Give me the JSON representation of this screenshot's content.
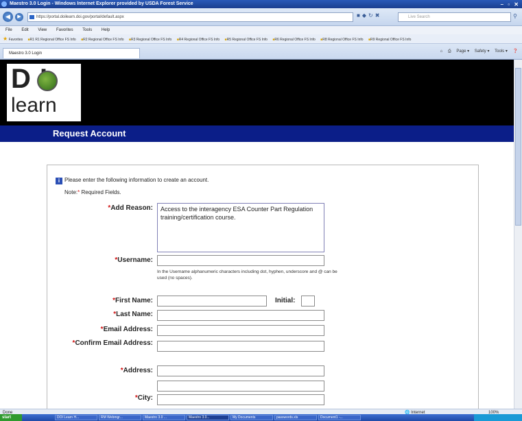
{
  "window": {
    "title": "Maestro 3.0 Login - Windows Internet Explorer provided by USDA Forest Service",
    "controls": "– ▫ ✕"
  },
  "browser": {
    "url": "https://portal.doilearn.doi.gov/portal/default.aspx",
    "search_placeholder": "Live Search",
    "menu": [
      "File",
      "Edit",
      "View",
      "Favorites",
      "Tools",
      "Help"
    ],
    "favorites_label": "Favorites",
    "favorites": [
      "R1 R1 Regional Office FS Info",
      "R2 Regional Office FS Info",
      "R3 Regional Office FS Info",
      "R4 Regional Office FS Info",
      "R5 Regional Office FS Info",
      "R6 Regional Office FS Info",
      "R8 Regional Office FS Info",
      "R9 Regional Office FS Info"
    ],
    "tab_label": "Maestro 3.0 Login",
    "commands": [
      "Page ▾",
      "Safety ▾",
      "Tools ▾"
    ],
    "status_left": "Done",
    "status_zone": "Internet",
    "status_zoom": "100%"
  },
  "site": {
    "logo_top": "D   I",
    "logo_bottom": "learn",
    "page_title": "Request Account"
  },
  "form": {
    "intro": "Please enter the following information to create an account.",
    "note_prefix": "Note:",
    "note_star": "*",
    "note_suffix": " Required Fields.",
    "required_mark": "*",
    "add_reason_label": "Add Reason:",
    "add_reason_value": "Access to the interagency ESA Counter Part Regulation training/certification course.",
    "username_label": "Username:",
    "username_hint": "In the Username alphanumeric characters including dot, hyphen, underscore and @ can be used (no spaces).",
    "first_name_label": "First Name:",
    "initial_label": "Initial:",
    "last_name_label": "Last Name:",
    "email_label": "Email Address:",
    "confirm_email_label": "Confirm Email Address:",
    "address_label": "Address:",
    "city_label": "City:"
  },
  "taskbar": {
    "start": "start",
    "items": [
      "DOI Learn H...",
      "RM Webmgr...",
      "Maestro 3.0 ...",
      "Maestro 3.0...",
      "My Documents",
      "passwords.xls",
      "Document1 -..."
    ],
    "tray": ""
  },
  "colors": {
    "header_bg": "#000000",
    "title_band": "#0b1e88",
    "required": "#d01010"
  }
}
